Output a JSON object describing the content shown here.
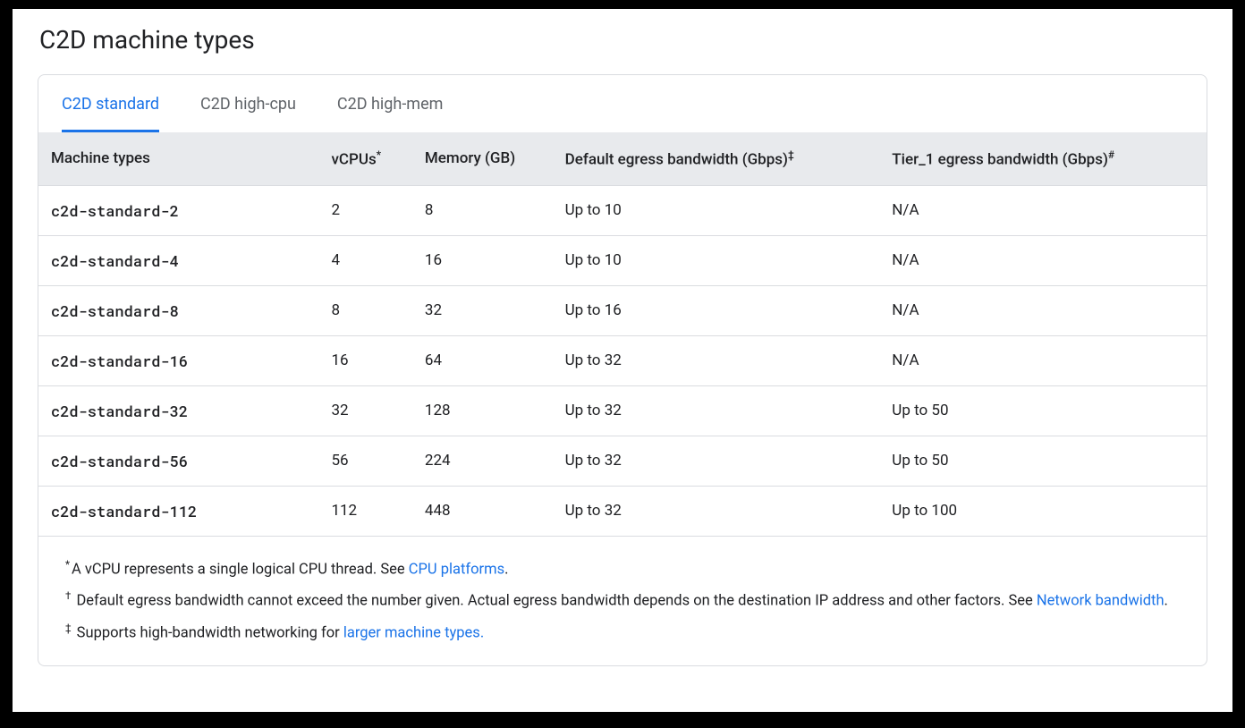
{
  "title": "C2D machine types",
  "tabs": [
    {
      "label": "C2D standard",
      "active": true
    },
    {
      "label": "C2D high-cpu",
      "active": false
    },
    {
      "label": "C2D high-mem",
      "active": false
    }
  ],
  "columns": [
    {
      "label": "Machine types",
      "sup": ""
    },
    {
      "label": "vCPUs",
      "sup": "*"
    },
    {
      "label": "Memory (GB)",
      "sup": ""
    },
    {
      "label": "Default egress bandwidth (Gbps)",
      "sup": "‡"
    },
    {
      "label": "Tier_1 egress bandwidth (Gbps)",
      "sup": "#"
    }
  ],
  "rows": [
    {
      "name": "c2d-standard-2",
      "vcpus": "2",
      "memory": "8",
      "default_egress": "Up to 10",
      "tier1_egress": "N/A"
    },
    {
      "name": "c2d-standard-4",
      "vcpus": "4",
      "memory": "16",
      "default_egress": "Up to 10",
      "tier1_egress": "N/A"
    },
    {
      "name": "c2d-standard-8",
      "vcpus": "8",
      "memory": "32",
      "default_egress": "Up to 16",
      "tier1_egress": "N/A"
    },
    {
      "name": "c2d-standard-16",
      "vcpus": "16",
      "memory": "64",
      "default_egress": "Up to 32",
      "tier1_egress": "N/A"
    },
    {
      "name": "c2d-standard-32",
      "vcpus": "32",
      "memory": "128",
      "default_egress": "Up to 32",
      "tier1_egress": "Up to 50"
    },
    {
      "name": "c2d-standard-56",
      "vcpus": "56",
      "memory": "224",
      "default_egress": "Up to 32",
      "tier1_egress": "Up to 50"
    },
    {
      "name": "c2d-standard-112",
      "vcpus": "112",
      "memory": "448",
      "default_egress": "Up to 32",
      "tier1_egress": "Up to 100"
    }
  ],
  "footnotes": {
    "f1_sup": "*",
    "f1_text": "A vCPU represents a single logical CPU thread. See ",
    "f1_link": "CPU platforms",
    "f1_after": ".",
    "f2_sup": "†",
    "f2_text": " Default egress bandwidth cannot exceed the number given. Actual egress bandwidth depends on the destination IP address and other factors. See ",
    "f2_link": "Network bandwidth",
    "f2_after": ".",
    "f3_sup": "‡",
    "f3_text": " Supports high-bandwidth networking for ",
    "f3_link": "larger machine types.",
    "f3_after": ""
  },
  "chart_data": {
    "type": "table",
    "title": "C2D machine types — C2D standard",
    "columns": [
      "Machine types",
      "vCPUs",
      "Memory (GB)",
      "Default egress bandwidth (Gbps)",
      "Tier_1 egress bandwidth (Gbps)"
    ],
    "rows": [
      [
        "c2d-standard-2",
        2,
        8,
        "Up to 10",
        "N/A"
      ],
      [
        "c2d-standard-4",
        4,
        16,
        "Up to 10",
        "N/A"
      ],
      [
        "c2d-standard-8",
        8,
        32,
        "Up to 16",
        "N/A"
      ],
      [
        "c2d-standard-16",
        16,
        64,
        "Up to 32",
        "N/A"
      ],
      [
        "c2d-standard-32",
        32,
        128,
        "Up to 32",
        "Up to 50"
      ],
      [
        "c2d-standard-56",
        56,
        224,
        "Up to 32",
        "Up to 50"
      ],
      [
        "c2d-standard-112",
        112,
        448,
        "Up to 32",
        "Up to 100"
      ]
    ]
  }
}
